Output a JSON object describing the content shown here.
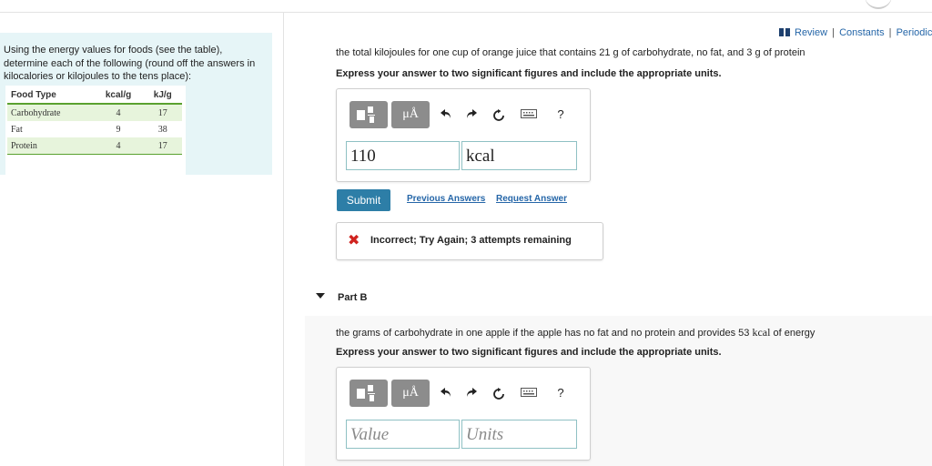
{
  "intro_text": "Using the energy values for foods (see the table), determine each of the following (round off the answers in kilocalories or kilojoules to the tens place):",
  "food_table": {
    "headers": [
      "Food Type",
      "kcal/g",
      "kJ/g"
    ],
    "rows": [
      [
        "Carbohydrate",
        "4",
        "17"
      ],
      [
        "Fat",
        "9",
        "38"
      ],
      [
        "Protein",
        "4",
        "17"
      ]
    ]
  },
  "top_links": {
    "review": "Review",
    "separator": "|",
    "constants": "Constants",
    "periodic": "Periodic"
  },
  "part_a": {
    "question": "the total kilojoules for one cup of orange juice that contains 21 g of carbohydrate, no fat, and 3 g of protein",
    "instruction": "Express your answer to two significant figures and include the appropriate units.",
    "value": "110",
    "units": "kcal",
    "submit": "Submit",
    "previous_answers": "Previous Answers",
    "request_answer": "Request Answer",
    "feedback": "Incorrect; Try Again; 3 attempts remaining"
  },
  "part_b": {
    "title": "Part B",
    "question_pre": "the grams of carbohydrate in one apple if the apple has no fat and no protein and provides 53 ",
    "question_unit": "kcal",
    "question_post": " of energy",
    "instruction": "Express your answer to two significant figures and include the appropriate units.",
    "value_placeholder": "Value",
    "units_placeholder": "Units"
  },
  "toolbar": {
    "mu_label": "μÅ",
    "help": "?"
  },
  "colors": {
    "accent": "#2d7ea7",
    "link": "#2566a8",
    "panel": "#e6f5f7",
    "table_green": "#5aa12f",
    "error": "#d0231f"
  }
}
